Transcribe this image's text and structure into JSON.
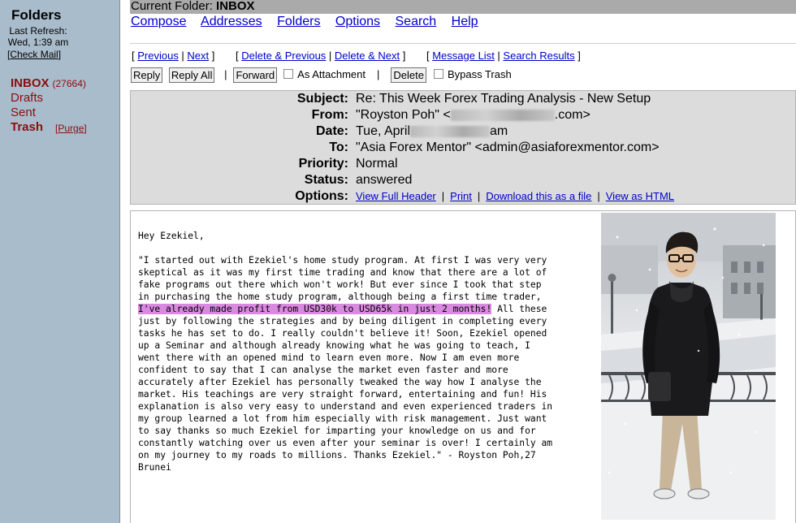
{
  "sidebar": {
    "title": "Folders",
    "refresh_line1": "Last Refresh:",
    "refresh_line2": "Wed, 1:39 am",
    "check_mail": "Check Mail",
    "folders": {
      "inbox": "INBOX",
      "inbox_count": "(27664)",
      "drafts": "Drafts",
      "sent": "Sent",
      "trash": "Trash",
      "purge": "Purge"
    }
  },
  "current_folder": {
    "label": "Current Folder:",
    "name": "INBOX"
  },
  "top_links": {
    "compose": "Compose",
    "addresses": "Addresses",
    "folders": "Folders",
    "options": "Options",
    "search": "Search",
    "help": "Help"
  },
  "nav": {
    "previous": "Previous",
    "next": "Next",
    "delete_previous": "Delete & Previous",
    "delete_next": "Delete & Next",
    "message_list": "Message List",
    "search_results": "Search Results"
  },
  "actions": {
    "reply": "Reply",
    "reply_all": "Reply All",
    "forward": "Forward",
    "as_attachment": "As Attachment",
    "delete": "Delete",
    "bypass_trash": "Bypass Trash"
  },
  "headers": {
    "subject_label": "Subject:",
    "subject": "Re: This Week Forex Trading Analysis - New Setup",
    "from_label": "From:",
    "from_name": "\"Royston Poh\" <",
    "from_domain": ".com>",
    "date_label": "Date:",
    "date_start": "Tue, April",
    "date_end": "am",
    "to_label": "To:",
    "to": "\"Asia Forex Mentor\" <admin@asiaforexmentor.com>",
    "priority_label": "Priority:",
    "priority": "Normal",
    "status_label": "Status:",
    "status": "answered",
    "options_label": "Options:",
    "options": {
      "view_full_header": "View Full Header",
      "print": "Print",
      "download": "Download this as a file",
      "view_html": "View as HTML"
    }
  },
  "message": {
    "greeting": "Hey Ezekiel,",
    "lines_before": "\"I started out with Ezekiel's home study program. At first I was very very\nskeptical as it was my first time trading and know that there are a lot of\nfake programs out there which won't work! But ever since I took that step\nin purchasing the home study program, although being a first time trader,\n",
    "highlight": "I've already made profit from USD30k to USD65k in just 2 months!",
    "after_highlight": " All these",
    "lines_after": "\njust by following the strategies and by being diligent in completing every\ntasks he has set to do. I really couldn't believe it! Soon, Ezekiel opened\nup a Seminar and although already knowing what he was going to teach, I\nwent there with an opened mind to learn even more. Now I am even more\nconfident to say that I can analyse the market even faster and more\naccurately after Ezekiel has personally tweaked the way how I analyse the\nmarket. His teachings are very straight forward, entertaining and fun! His\nexplanation is also very easy to understand and even experienced traders in\nmy group learned a lot from him especially with risk management. Just want\nto say thanks so much Ezekiel for imparting your knowledge on us and for\nconstantly watching over us even after your seminar is over! I certainly am\non my journey to my roads to millions. Thanks Ezekiel.\" - Royston Poh,27\nBrunei"
  }
}
